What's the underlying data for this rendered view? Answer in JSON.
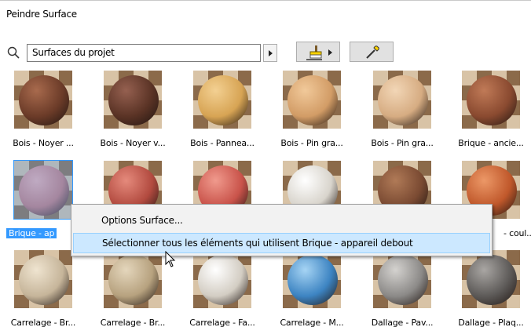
{
  "window": {
    "title": "Peindre Surface"
  },
  "toolbar": {
    "search_icon": "search-icon",
    "source_value": "Surfaces du projet",
    "paint_icon": "paint-brush-icon",
    "picker_icon": "eyedropper-icon"
  },
  "materials": [
    {
      "label": "Bois - Noyer ...",
      "color": "#6b3b28",
      "highlight": "#a86a4d"
    },
    {
      "label": "Bois - Noyer v...",
      "color": "#5a3325",
      "highlight": "#956050"
    },
    {
      "label": "Bois - Pannea...",
      "color": "#d7a454",
      "highlight": "#f3d092"
    },
    {
      "label": "Bois - Pin gra...",
      "color": "#d29c66",
      "highlight": "#f1c99a"
    },
    {
      "label": "Bois - Pin gra...",
      "color": "#d6ac82",
      "highlight": "#f2d6b6"
    },
    {
      "label": "Brique - ancie...",
      "color": "#8a4a30",
      "highlight": "#c07a57"
    },
    {
      "label": "Brique - ap",
      "color": "#c7797a",
      "highlight": "#f0b0b0",
      "selected": true
    },
    {
      "label": "",
      "color": "#b24a3f",
      "highlight": "#e58a7c"
    },
    {
      "label": "",
      "color": "#c9534a",
      "highlight": "#f09a8d"
    },
    {
      "label": "",
      "color": "#d8d4cc",
      "highlight": "#ffffff"
    },
    {
      "label": "",
      "color": "#7a4a32",
      "highlight": "#b07a57"
    },
    {
      "label": "- coul...",
      "color": "#c0582b",
      "highlight": "#ec9867"
    },
    {
      "label": "Carrelage - Br...",
      "color": "#c6b59a",
      "highlight": "#efe4d0"
    },
    {
      "label": "Carrelage - Br...",
      "color": "#b7a27f",
      "highlight": "#e4d6bc"
    },
    {
      "label": "Carrelage - Fa...",
      "color": "#d3cdc3",
      "highlight": "#ffffff"
    },
    {
      "label": "Carrelage - M...",
      "color": "#3d84c2",
      "highlight": "#a6d4f4"
    },
    {
      "label": "Dallage - Pav...",
      "color": "#8c8a88",
      "highlight": "#d4d2cf"
    },
    {
      "label": "Dallage - Plaq...",
      "color": "#5d5a58",
      "highlight": "#a9a6a3"
    }
  ],
  "context_menu": {
    "items": [
      {
        "label": "Options Surface..."
      },
      {
        "label": "Sélectionner tous les éléments qui utilisent Brique - appareil debout"
      }
    ]
  }
}
